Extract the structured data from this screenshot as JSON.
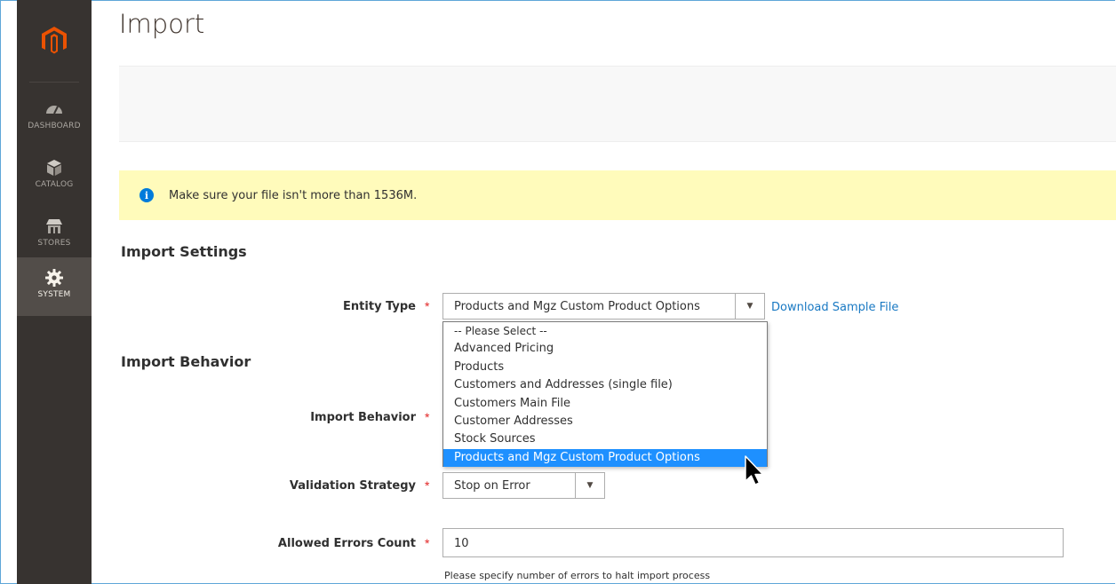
{
  "sidebar": {
    "items": [
      {
        "label": "DASHBOARD",
        "icon": "dashboard-icon"
      },
      {
        "label": "CATALOG",
        "icon": "catalog-icon"
      },
      {
        "label": "STORES",
        "icon": "stores-icon"
      },
      {
        "label": "SYSTEM",
        "icon": "system-gear-icon",
        "active": true
      }
    ]
  },
  "page": {
    "title": "Import"
  },
  "notice": {
    "text": "Make sure your file isn't more than 1536M."
  },
  "import_settings": {
    "title": "Import Settings",
    "entity_type": {
      "label": "Entity Type",
      "value": "Products and Mgz Custom Product Options",
      "download_link": "Download Sample File",
      "options": [
        "-- Please Select --",
        "Advanced Pricing",
        "Products",
        "Customers and Addresses (single file)",
        "Customers Main File",
        "Customer Addresses",
        "Stock Sources",
        "Products and Mgz Custom Product Options"
      ],
      "selected_index": 7
    }
  },
  "import_behavior": {
    "title": "Import Behavior",
    "behavior_label": "Import Behavior",
    "validation": {
      "label": "Validation Strategy",
      "value": "Stop on Error"
    },
    "allowed_errors": {
      "label": "Allowed Errors Count",
      "value": "10",
      "note": "Please specify number of errors to halt import process"
    }
  },
  "colors": {
    "sidebar_bg": "#373330",
    "sidebar_active": "#524d49",
    "logo_orange": "#eb5202",
    "notice_bg": "#fffbbb",
    "link": "#1979c3",
    "selected_option": "#1e90ff",
    "required": "#e22626"
  }
}
